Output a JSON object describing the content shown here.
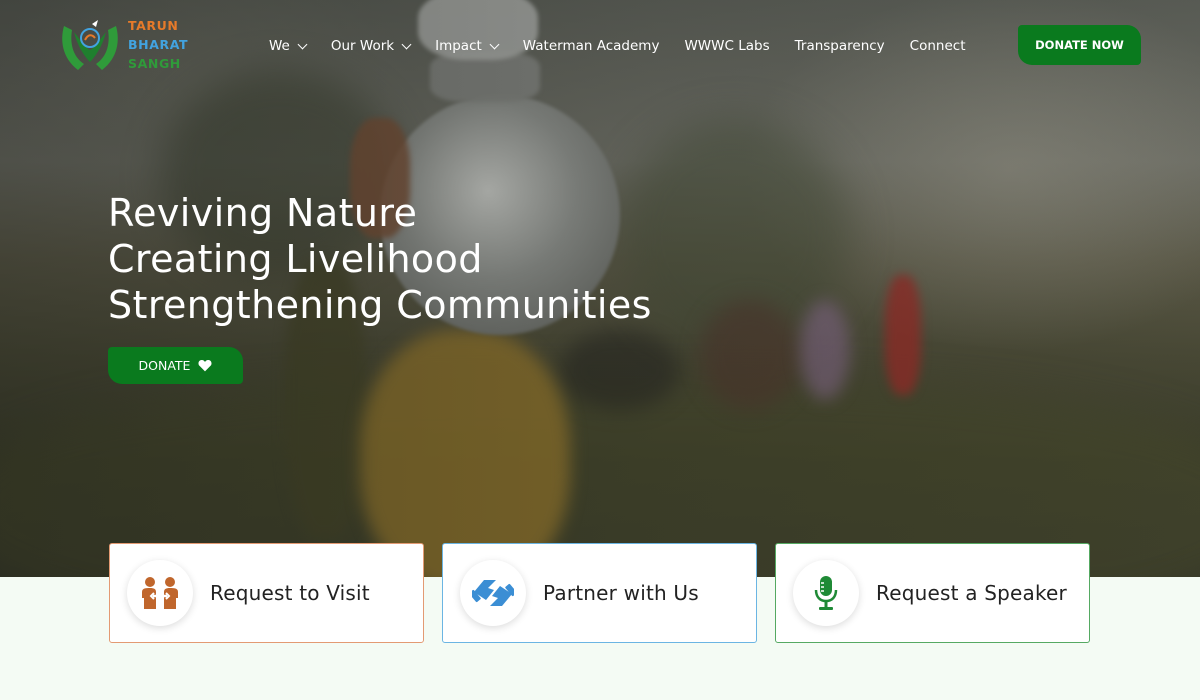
{
  "brand": {
    "line1": "TARUN",
    "line2": "BHARAT",
    "line3": "SANGH",
    "colors": {
      "line1": "#e67a2a",
      "line2": "#42a3e0",
      "line3": "#2f9b3a"
    }
  },
  "nav": {
    "items": [
      {
        "label": "We",
        "has_dropdown": true
      },
      {
        "label": "Our Work",
        "has_dropdown": true
      },
      {
        "label": "Impact",
        "has_dropdown": true
      },
      {
        "label": "Waterman Academy",
        "has_dropdown": false
      },
      {
        "label": "WWWC Labs",
        "has_dropdown": false
      },
      {
        "label": "Transparency",
        "has_dropdown": false
      },
      {
        "label": "Connect",
        "has_dropdown": false
      }
    ],
    "cta_label": "DONATE NOW"
  },
  "hero": {
    "lines": [
      "Reviving Nature",
      "Creating Livelihood",
      "Strengthening Communities"
    ],
    "button_label": "DONATE",
    "button_icon": "heart-icon"
  },
  "cards": [
    {
      "label": "Request to Visit",
      "icon": "people-icon",
      "accent": "#e39a73"
    },
    {
      "label": "Partner with Us",
      "icon": "handshake-icon",
      "accent": "#6bb5e3"
    },
    {
      "label": "Request a Speaker",
      "icon": "microphone-icon",
      "accent": "#55a962"
    }
  ],
  "colors": {
    "primary_green": "#0a7a1e",
    "page_bg": "#f4fbf4"
  }
}
